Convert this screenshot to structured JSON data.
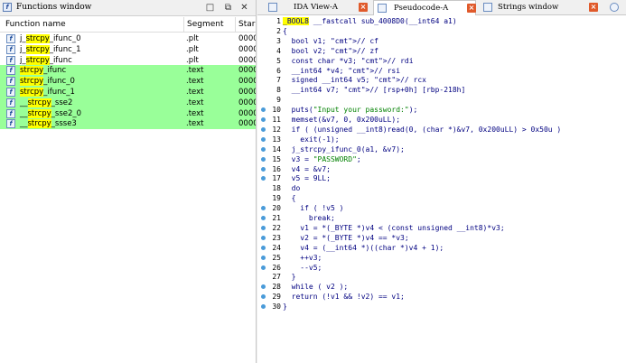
{
  "functions_window": {
    "title": "Functions window",
    "columns": [
      "Function name",
      "Segment",
      "Star"
    ],
    "rows": [
      {
        "prefix": "j_",
        "hl": "strcpy",
        "suffix": "_ifunc_0",
        "segment": ".plt",
        "start": "0000",
        "highlight": false
      },
      {
        "prefix": "j_",
        "hl": "strcpy",
        "suffix": "_ifunc_1",
        "segment": ".plt",
        "start": "0000",
        "highlight": false
      },
      {
        "prefix": "j_",
        "hl": "strcpy",
        "suffix": "_ifunc",
        "segment": ".plt",
        "start": "0000",
        "highlight": false
      },
      {
        "prefix": "",
        "hl": "strcpy",
        "suffix": "_ifunc",
        "segment": ".text",
        "start": "0000",
        "highlight": true
      },
      {
        "prefix": "",
        "hl": "strcpy",
        "suffix": "_ifunc_0",
        "segment": ".text",
        "start": "0000",
        "highlight": true
      },
      {
        "prefix": "",
        "hl": "strcpy",
        "suffix": "_ifunc_1",
        "segment": ".text",
        "start": "0000",
        "highlight": true
      },
      {
        "prefix": "__",
        "hl": "strcpy",
        "suffix": "_sse2",
        "segment": ".text",
        "start": "0000",
        "highlight": true
      },
      {
        "prefix": "__",
        "hl": "strcpy",
        "suffix": "_sse2_0",
        "segment": ".text",
        "start": "0000",
        "highlight": true
      },
      {
        "prefix": "__",
        "hl": "strcpy",
        "suffix": "_ssse3",
        "segment": ".text",
        "start": "0000",
        "highlight": true
      }
    ]
  },
  "tabs": [
    {
      "label": "IDA View-A",
      "active": false
    },
    {
      "label": "Pseudocode-A",
      "active": true
    },
    {
      "label": "Strings window",
      "active": false
    }
  ],
  "code_lines": [
    {
      "n": "1",
      "dot": false,
      "text": "_BOOL8 __fastcall sub_4008D0(__int64 a1)"
    },
    {
      "n": "2",
      "dot": false,
      "text": "{"
    },
    {
      "n": "3",
      "dot": false,
      "text": "  bool v1; // cf"
    },
    {
      "n": "4",
      "dot": false,
      "text": "  bool v2; // zf"
    },
    {
      "n": "5",
      "dot": false,
      "text": "  const char *v3; // rdi"
    },
    {
      "n": "6",
      "dot": false,
      "text": "  __int64 *v4; // rsi"
    },
    {
      "n": "7",
      "dot": false,
      "text": "  signed __int64 v5; // rcx"
    },
    {
      "n": "8",
      "dot": false,
      "text": "  __int64 v7; // [rsp+0h] [rbp-218h]"
    },
    {
      "n": "9",
      "dot": false,
      "text": ""
    },
    {
      "n": "10",
      "dot": true,
      "text": "  puts(\"Input your password:\");"
    },
    {
      "n": "11",
      "dot": true,
      "text": "  memset(&v7, 0, 0x200uLL);"
    },
    {
      "n": "12",
      "dot": true,
      "text": "  if ( (unsigned __int8)read(0, (char *)&v7, 0x200uLL) > 0x50u )"
    },
    {
      "n": "13",
      "dot": true,
      "text": "    exit(-1);"
    },
    {
      "n": "14",
      "dot": true,
      "text": "  j_strcpy_ifunc_0(a1, &v7);"
    },
    {
      "n": "15",
      "dot": true,
      "text": "  v3 = \"PASSWORD\";"
    },
    {
      "n": "16",
      "dot": true,
      "text": "  v4 = &v7;"
    },
    {
      "n": "17",
      "dot": true,
      "text": "  v5 = 9LL;"
    },
    {
      "n": "18",
      "dot": false,
      "text": "  do"
    },
    {
      "n": "19",
      "dot": false,
      "text": "  {"
    },
    {
      "n": "20",
      "dot": true,
      "text": "    if ( !v5 )"
    },
    {
      "n": "21",
      "dot": true,
      "text": "      break;"
    },
    {
      "n": "22",
      "dot": true,
      "text": "    v1 = *(_BYTE *)v4 < (const unsigned __int8)*v3;"
    },
    {
      "n": "23",
      "dot": true,
      "text": "    v2 = *(_BYTE *)v4 == *v3;"
    },
    {
      "n": "24",
      "dot": true,
      "text": "    v4 = (__int64 *)((char *)v4 + 1);"
    },
    {
      "n": "25",
      "dot": true,
      "text": "    ++v3;"
    },
    {
      "n": "26",
      "dot": true,
      "text": "    --v5;"
    },
    {
      "n": "27",
      "dot": false,
      "text": "  }"
    },
    {
      "n": "28",
      "dot": true,
      "text": "  while ( v2 );"
    },
    {
      "n": "29",
      "dot": true,
      "text": "  return (!v1 && !v2) == v1;"
    },
    {
      "n": "30",
      "dot": true,
      "text": "}"
    }
  ],
  "colors": {
    "highlight_row": "#99ff99",
    "search_highlight": "#ffff00",
    "breakpoint_dot": "#4a9bd9",
    "tab_close": "#e05a2b"
  },
  "icons": [
    "function-icon",
    "close-icon",
    "restore-icon",
    "pin-icon",
    "pseudocode-icon",
    "strings-icon"
  ]
}
